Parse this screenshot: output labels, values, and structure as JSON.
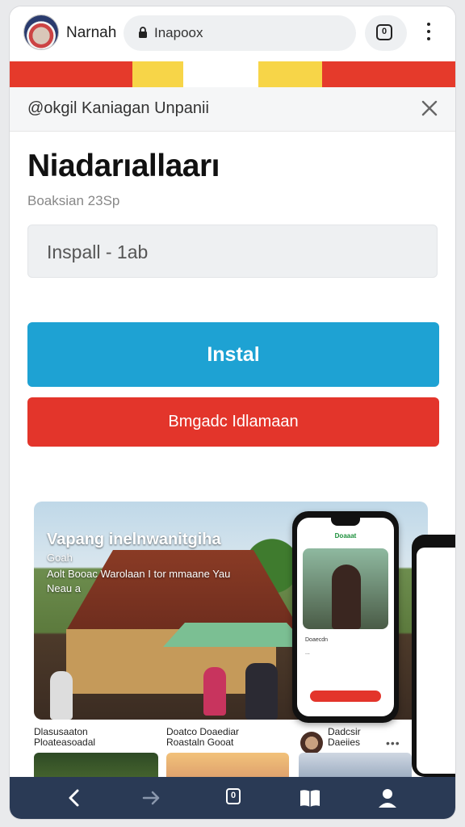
{
  "browser": {
    "site_name": "Narnah",
    "url": "Inapoox",
    "tab_count": "0"
  },
  "colors": {
    "accent_blue": "#1ea2d3",
    "accent_red": "#e3352b",
    "nav_bg": "#2a3a55"
  },
  "promo": {
    "header_title": "@okgil Kaniagan Unpanii",
    "title": "Niadarıallaarı",
    "subtitle": "Boaksian 23Sp",
    "input_value": "Inspall - 1ab",
    "install_label": "Instal",
    "secondary_label": "Bmgadc Idlamaan"
  },
  "hero": {
    "title": "Vapang inelnwanitgiha",
    "line1": "Goah",
    "line2": "Aolt Booac Warolaan I tor mmaane Yau",
    "line3": "Neau a",
    "phone_top": "Doaaat",
    "phone_item1": "Doaecdn",
    "phone_item2": "..."
  },
  "captions": {
    "left_line1": "Dlasusaaton",
    "left_line2": "Ploateasoadal",
    "mid_line1": "Doatco Doaediar",
    "mid_line2": "Roastaln Gooat",
    "right_line1": "Dadcsir",
    "right_line2": "Daeiies"
  },
  "icons": {
    "back": "chevron-left-icon",
    "forward": "chevron-right-icon",
    "tabs": "tabs-icon",
    "bookmarks": "book-icon",
    "profile": "person-icon"
  }
}
